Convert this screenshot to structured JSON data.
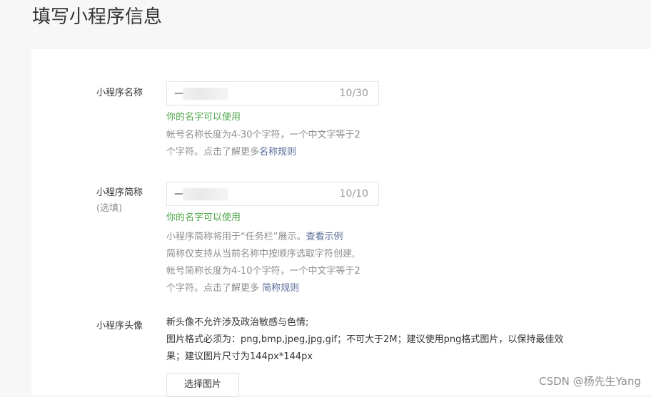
{
  "page": {
    "title": "填写小程序信息"
  },
  "name_field": {
    "label": "小程序名称",
    "value": "—",
    "counter": "10/30",
    "status": "你的名字可以使用",
    "hint_line1": "帐号名称长度为4-30个字符，一个中文字等于2",
    "hint_line2_prefix": "个字符。点击了解更多",
    "hint_link": "名称规则"
  },
  "short_name_field": {
    "label": "小程序简称",
    "label_sub": "(选填)",
    "value": "—",
    "counter": "10/10",
    "status": "你的名字可以使用",
    "hint_line1_prefix": "小程序简称将用于“任务栏”展示。",
    "hint_link1": "查看示例",
    "hint_line2": "简称仅支持从当前名称中按顺序选取字符创建,",
    "hint_line3": "帐号简称长度为4-10个字符，一个中文字等于2",
    "hint_line4_prefix": "个字符。点击了解更多 ",
    "hint_link2": "简称规则"
  },
  "avatar_field": {
    "label": "小程序头像",
    "desc_line1": "新头像不允许涉及政治敏感与色情;",
    "desc_line2": "图片格式必须为：png,bmp,jpeg,jpg,gif；不可大于2M；建议使用png格式图片，以保持最佳效",
    "desc_line3": "果；建议图片尺寸为144px*144px",
    "choose_button": "选择图片"
  },
  "watermark": "CSDN @杨先生Yang",
  "colors": {
    "success": "#4fa74b",
    "link": "#576b95",
    "hint": "#8d8d8d"
  }
}
